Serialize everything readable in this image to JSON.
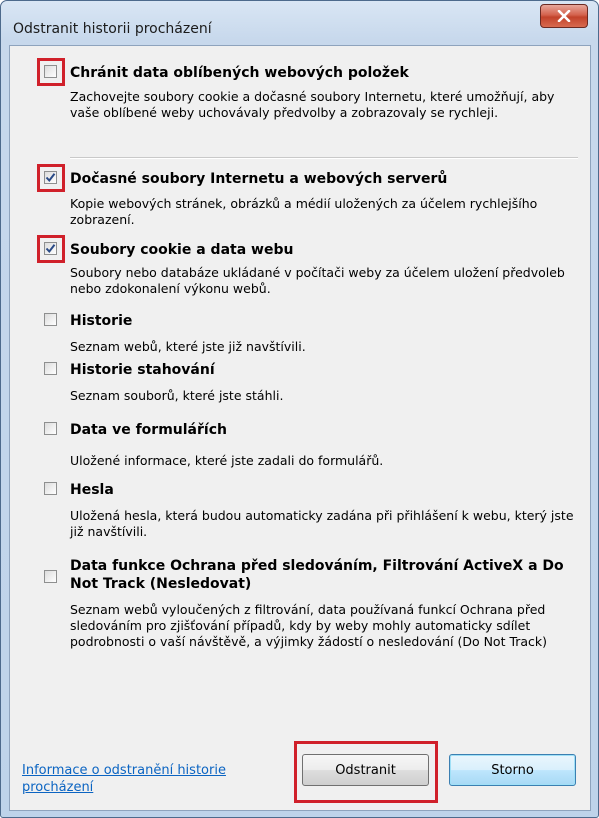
{
  "window": {
    "title": "Odstranit historii procházení",
    "close_icon": "close-x-icon"
  },
  "options": [
    {
      "id": "favorites",
      "label": "Chránit data oblíbených webových položek",
      "checked": false,
      "highlighted": true,
      "description": "Zachovejte soubory cookie a dočasné soubory Internetu, které umožňují, aby vaše oblíbené weby uchovávaly předvolby a zobrazovaly se rychleji."
    },
    {
      "id": "temp_files",
      "label": "Dočasné soubory Internetu a webových serverů",
      "checked": true,
      "highlighted": true,
      "description": "Kopie webových stránek, obrázků a médií uložených za účelem rychlejšího zobrazení."
    },
    {
      "id": "cookies",
      "label": "Soubory cookie a data webu",
      "checked": true,
      "highlighted": true,
      "description": "Soubory nebo databáze ukládané v počítači weby za účelem uložení předvoleb nebo zdokonalení výkonu webů."
    },
    {
      "id": "history",
      "label": "Historie",
      "checked": false,
      "highlighted": false,
      "description": "Seznam webů, které jste již navštívili."
    },
    {
      "id": "downloads",
      "label": "Historie stahování",
      "checked": false,
      "highlighted": false,
      "description": "Seznam souborů, které jste stáhli."
    },
    {
      "id": "forms",
      "label": "Data ve formulářích",
      "checked": false,
      "highlighted": false,
      "description": "Uložené informace, které jste zadali do formulářů."
    },
    {
      "id": "passwords",
      "label": "Hesla",
      "checked": false,
      "highlighted": false,
      "description": "Uložená hesla, která budou automaticky zadána při přihlášení k webu, který jste již navštívili."
    },
    {
      "id": "tracking",
      "label": "Data funkce Ochrana před sledováním, Filtrování ActiveX a Do Not Track (Nesledovat)",
      "checked": false,
      "highlighted": false,
      "description": "Seznam webů vyloučených z filtrování, data používaná funkcí Ochrana před sledováním pro zjišťování případů, kdy by weby mohly automaticky sdílet podrobnosti o vaší návštěvě, a výjimky žádostí o nesledování (Do Not Track)"
    }
  ],
  "footer": {
    "info_link": "Informace o odstranění historie procházení",
    "delete_label": "Odstranit",
    "cancel_label": "Storno"
  },
  "colors": {
    "highlight": "#d0202a",
    "link": "#0b64c2"
  }
}
